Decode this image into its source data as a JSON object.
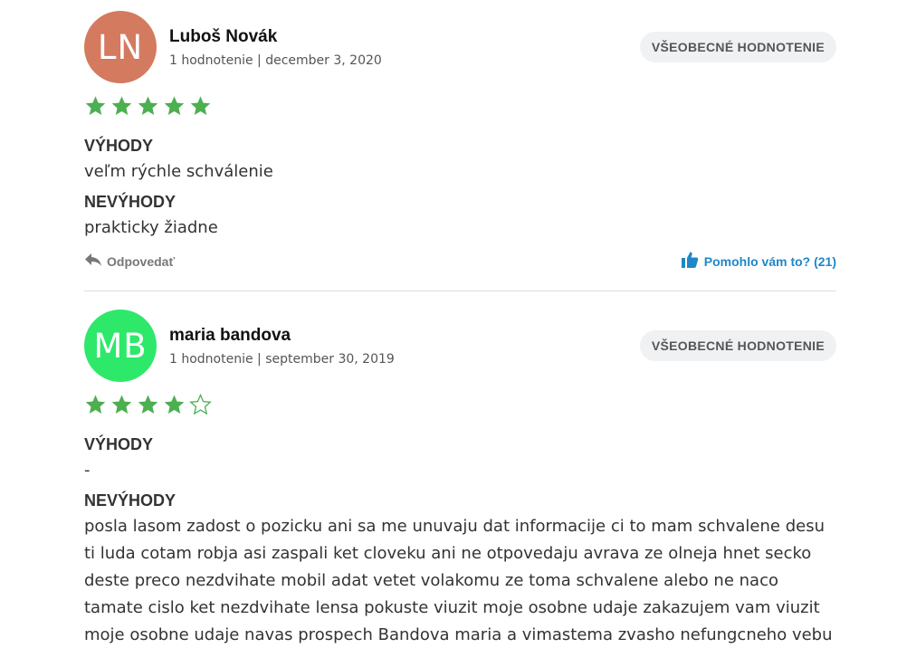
{
  "reviews": [
    {
      "initials": "LN",
      "avatar_color": "#d47a5f",
      "name": "Luboš Novák",
      "meta": "1 hodnotenie | december 3, 2020",
      "badge": "VŠEOBECNÉ HODNOTENIE",
      "rating": 5,
      "rating_max": 5,
      "pros_label": "VÝHODY",
      "pros": "veľm rýchle schválenie",
      "cons_label": "NEVÝHODY",
      "cons": "prakticky žiadne",
      "reply_label": "Odpovedať",
      "helpful_label": "Pomohlo vám to? (21)"
    },
    {
      "initials": "MB",
      "avatar_color": "#2ee86a",
      "name": "maria bandova",
      "meta": "1 hodnotenie | september 30, 2019",
      "badge": "VŠEOBECNÉ HODNOTENIE",
      "rating": 4,
      "rating_max": 5,
      "pros_label": "VÝHODY",
      "pros": "-",
      "cons_label": "NEVÝHODY",
      "cons": "posla lasom zadost o pozicku ani sa me unuvaju dat informacije ci to mam schvalene desu ti luda cotam robja asi zaspali ket cloveku ani ne otpovedaju avrava ze olneja hnet secko deste preco nezdvihate mobil adat vetet volakomu ze toma schvalene alebo ne naco tamate cislo ket nezdvihate lensa pokuste viuzit moje osobne udaje zakazujem vam viuzit moje osobne udaje navas prospech Bandova maria a vimastema zvasho nefungcneho vebu"
    }
  ],
  "colors": {
    "star_filled": "#4caf50",
    "helpful": "#1f87c8"
  },
  "icons": {
    "reply": "reply-arrow-icon",
    "helpful": "thumbs-up-icon",
    "star": "star-icon"
  }
}
